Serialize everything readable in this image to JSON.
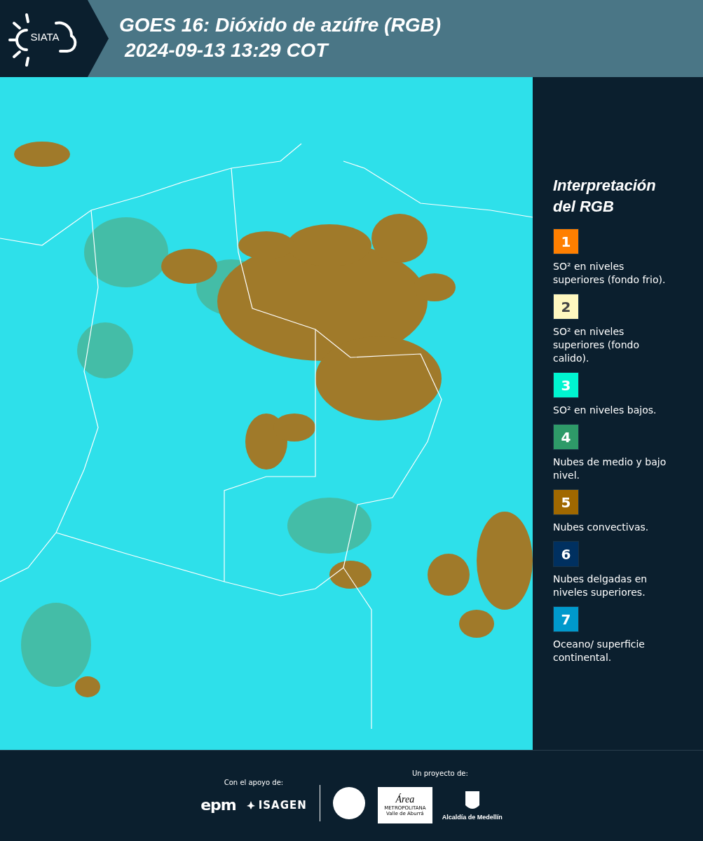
{
  "header": {
    "logo": "SIATA",
    "title": "GOES 16: Dióxido de azúfre (RGB)",
    "timestamp": "2024-09-13 13:29 COT"
  },
  "legend": {
    "title": "Interpretación del RGB",
    "items": [
      {
        "number": "1",
        "color": "#ff7f00",
        "text": "SO² en niveles superiores (fondo frio)."
      },
      {
        "number": "2",
        "color": "#fff8c0",
        "text": "SO² en niveles superiores (fondo calido)."
      },
      {
        "number": "3",
        "color": "#00f5d0",
        "text": "SO² en niveles bajos."
      },
      {
        "number": "4",
        "color": "#2e9a68",
        "text": "Nubes de medio y bajo nivel."
      },
      {
        "number": "5",
        "color": "#a06800",
        "text": "Nubes convectivas."
      },
      {
        "number": "6",
        "color": "#003060",
        "text": "Nubes delgadas en niveles superiores."
      },
      {
        "number": "7",
        "color": "#0099cc",
        "text": "Oceano/ superficie continental."
      }
    ]
  },
  "footer": {
    "support_label": "Con el apoyo de:",
    "supporters": [
      "epm",
      "ISAGEN"
    ],
    "project_label": "Un proyecto de:",
    "area_logo": {
      "title": "Área",
      "line_1": "METROPOLITANA",
      "line_2": "Valle de Aburrá"
    },
    "city_logo": "Alcaldía de Medellín"
  }
}
